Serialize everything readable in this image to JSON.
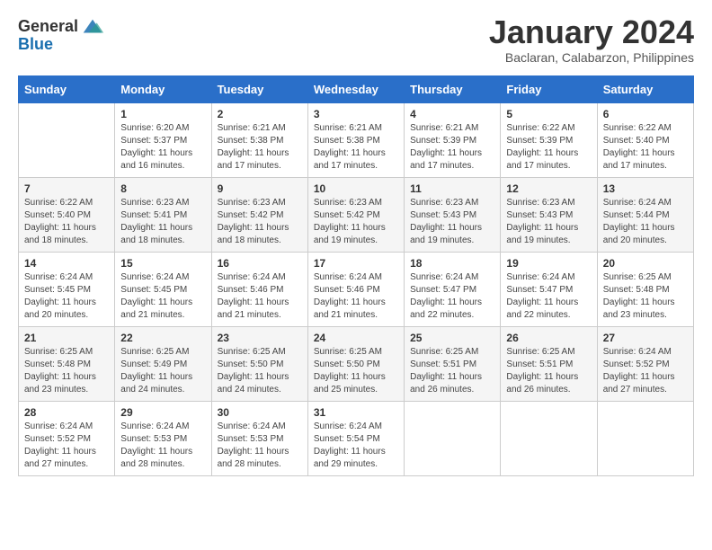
{
  "header": {
    "logo_general": "General",
    "logo_blue": "Blue",
    "month_title": "January 2024",
    "location": "Baclaran, Calabarzon, Philippines"
  },
  "weekdays": [
    "Sunday",
    "Monday",
    "Tuesday",
    "Wednesday",
    "Thursday",
    "Friday",
    "Saturday"
  ],
  "weeks": [
    [
      {
        "day": "",
        "sunrise": "",
        "sunset": "",
        "daylight": ""
      },
      {
        "day": "1",
        "sunrise": "6:20 AM",
        "sunset": "5:37 PM",
        "daylight": "11 hours and 16 minutes."
      },
      {
        "day": "2",
        "sunrise": "6:21 AM",
        "sunset": "5:38 PM",
        "daylight": "11 hours and 17 minutes."
      },
      {
        "day": "3",
        "sunrise": "6:21 AM",
        "sunset": "5:38 PM",
        "daylight": "11 hours and 17 minutes."
      },
      {
        "day": "4",
        "sunrise": "6:21 AM",
        "sunset": "5:39 PM",
        "daylight": "11 hours and 17 minutes."
      },
      {
        "day": "5",
        "sunrise": "6:22 AM",
        "sunset": "5:39 PM",
        "daylight": "11 hours and 17 minutes."
      },
      {
        "day": "6",
        "sunrise": "6:22 AM",
        "sunset": "5:40 PM",
        "daylight": "11 hours and 17 minutes."
      }
    ],
    [
      {
        "day": "7",
        "sunrise": "6:22 AM",
        "sunset": "5:40 PM",
        "daylight": "11 hours and 18 minutes."
      },
      {
        "day": "8",
        "sunrise": "6:23 AM",
        "sunset": "5:41 PM",
        "daylight": "11 hours and 18 minutes."
      },
      {
        "day": "9",
        "sunrise": "6:23 AM",
        "sunset": "5:42 PM",
        "daylight": "11 hours and 18 minutes."
      },
      {
        "day": "10",
        "sunrise": "6:23 AM",
        "sunset": "5:42 PM",
        "daylight": "11 hours and 19 minutes."
      },
      {
        "day": "11",
        "sunrise": "6:23 AM",
        "sunset": "5:43 PM",
        "daylight": "11 hours and 19 minutes."
      },
      {
        "day": "12",
        "sunrise": "6:23 AM",
        "sunset": "5:43 PM",
        "daylight": "11 hours and 19 minutes."
      },
      {
        "day": "13",
        "sunrise": "6:24 AM",
        "sunset": "5:44 PM",
        "daylight": "11 hours and 20 minutes."
      }
    ],
    [
      {
        "day": "14",
        "sunrise": "6:24 AM",
        "sunset": "5:45 PM",
        "daylight": "11 hours and 20 minutes."
      },
      {
        "day": "15",
        "sunrise": "6:24 AM",
        "sunset": "5:45 PM",
        "daylight": "11 hours and 21 minutes."
      },
      {
        "day": "16",
        "sunrise": "6:24 AM",
        "sunset": "5:46 PM",
        "daylight": "11 hours and 21 minutes."
      },
      {
        "day": "17",
        "sunrise": "6:24 AM",
        "sunset": "5:46 PM",
        "daylight": "11 hours and 21 minutes."
      },
      {
        "day": "18",
        "sunrise": "6:24 AM",
        "sunset": "5:47 PM",
        "daylight": "11 hours and 22 minutes."
      },
      {
        "day": "19",
        "sunrise": "6:24 AM",
        "sunset": "5:47 PM",
        "daylight": "11 hours and 22 minutes."
      },
      {
        "day": "20",
        "sunrise": "6:25 AM",
        "sunset": "5:48 PM",
        "daylight": "11 hours and 23 minutes."
      }
    ],
    [
      {
        "day": "21",
        "sunrise": "6:25 AM",
        "sunset": "5:48 PM",
        "daylight": "11 hours and 23 minutes."
      },
      {
        "day": "22",
        "sunrise": "6:25 AM",
        "sunset": "5:49 PM",
        "daylight": "11 hours and 24 minutes."
      },
      {
        "day": "23",
        "sunrise": "6:25 AM",
        "sunset": "5:50 PM",
        "daylight": "11 hours and 24 minutes."
      },
      {
        "day": "24",
        "sunrise": "6:25 AM",
        "sunset": "5:50 PM",
        "daylight": "11 hours and 25 minutes."
      },
      {
        "day": "25",
        "sunrise": "6:25 AM",
        "sunset": "5:51 PM",
        "daylight": "11 hours and 26 minutes."
      },
      {
        "day": "26",
        "sunrise": "6:25 AM",
        "sunset": "5:51 PM",
        "daylight": "11 hours and 26 minutes."
      },
      {
        "day": "27",
        "sunrise": "6:24 AM",
        "sunset": "5:52 PM",
        "daylight": "11 hours and 27 minutes."
      }
    ],
    [
      {
        "day": "28",
        "sunrise": "6:24 AM",
        "sunset": "5:52 PM",
        "daylight": "11 hours and 27 minutes."
      },
      {
        "day": "29",
        "sunrise": "6:24 AM",
        "sunset": "5:53 PM",
        "daylight": "11 hours and 28 minutes."
      },
      {
        "day": "30",
        "sunrise": "6:24 AM",
        "sunset": "5:53 PM",
        "daylight": "11 hours and 28 minutes."
      },
      {
        "day": "31",
        "sunrise": "6:24 AM",
        "sunset": "5:54 PM",
        "daylight": "11 hours and 29 minutes."
      },
      {
        "day": "",
        "sunrise": "",
        "sunset": "",
        "daylight": ""
      },
      {
        "day": "",
        "sunrise": "",
        "sunset": "",
        "daylight": ""
      },
      {
        "day": "",
        "sunrise": "",
        "sunset": "",
        "daylight": ""
      }
    ]
  ]
}
